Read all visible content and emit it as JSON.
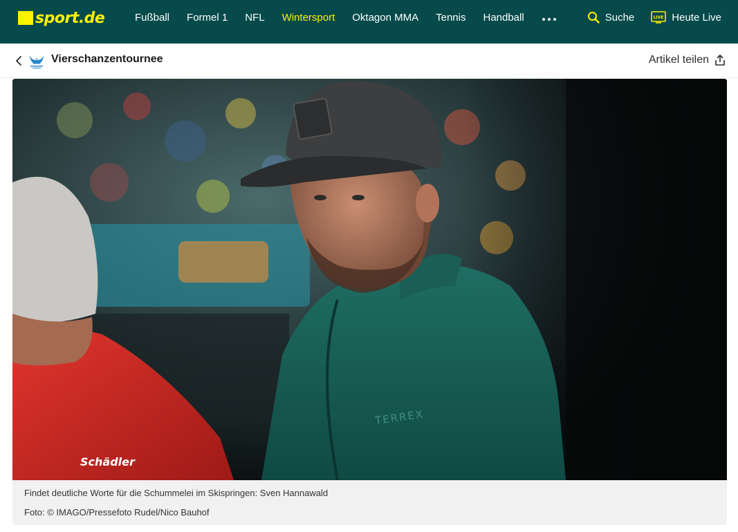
{
  "brand": {
    "logo_text": "sport.de",
    "accent": "#fff200",
    "nav_bg": "#064a4b"
  },
  "nav": {
    "items": [
      {
        "label": "Fußball",
        "active": false
      },
      {
        "label": "Formel 1",
        "active": false
      },
      {
        "label": "NFL",
        "active": false
      },
      {
        "label": "Wintersport",
        "active": true
      },
      {
        "label": "Oktagon MMA",
        "active": false
      },
      {
        "label": "Tennis",
        "active": false
      },
      {
        "label": "Handball",
        "active": false
      }
    ],
    "more_label": "•••"
  },
  "tools": {
    "search_label": "Suche",
    "live_badge": "LIVE",
    "live_label": "Heute Live"
  },
  "breadcrumb": {
    "title": "Vierschanzentournee",
    "share_label": "Artikel teilen"
  },
  "hero": {
    "image_icon": "photo-man-in-cap-icon",
    "jacket_text": "TERREX",
    "left_jacket_text": "Schädler"
  },
  "caption": {
    "text": "Findet deutliche Worte für die Schummelei im Skispringen: Sven Hannawald",
    "credit": "Foto: © IMAGO/Pressefoto Rudel/Nico Bauhof"
  }
}
